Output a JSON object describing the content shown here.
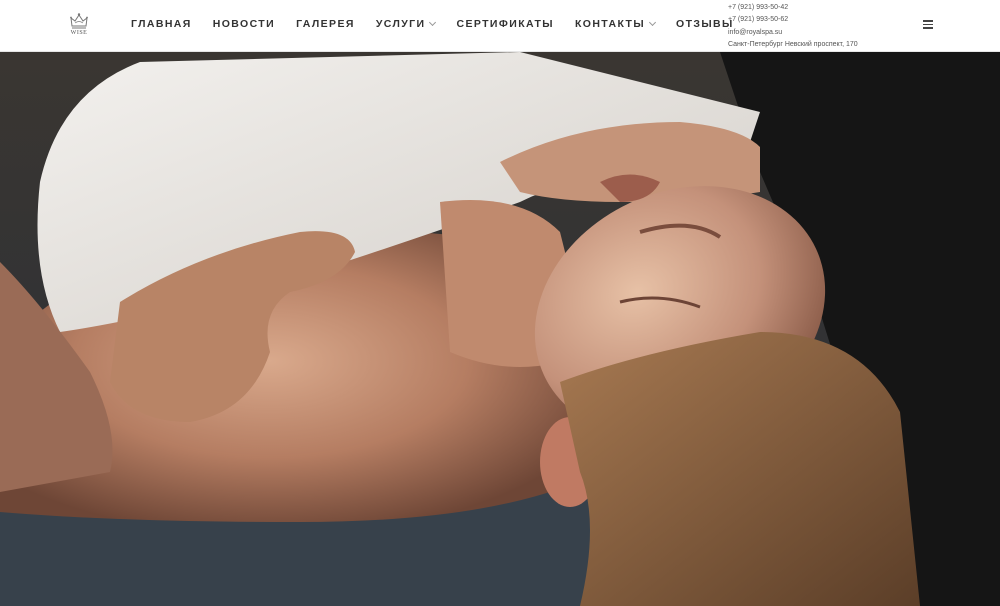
{
  "brand": {
    "logo_text": "WISE"
  },
  "nav": {
    "items": [
      {
        "label": "ГЛАВНАЯ",
        "dropdown": false
      },
      {
        "label": "НОВОСТИ",
        "dropdown": false
      },
      {
        "label": "ГАЛЕРЕЯ",
        "dropdown": false
      },
      {
        "label": "УСЛУГИ",
        "dropdown": true
      },
      {
        "label": "СЕРТИФИКАТЫ",
        "dropdown": false
      },
      {
        "label": "КОНТАКТЫ",
        "dropdown": true
      },
      {
        "label": "ОТЗЫВЫ",
        "dropdown": false
      }
    ]
  },
  "contacts": {
    "phone1": "+7 (921) 993-50-42",
    "phone2": "+7 (921) 993-50-62",
    "email": "info@royalspa.su",
    "address": "Санкт-Петербург Невский проспект, 170"
  },
  "icons": {
    "logo": "crown-emblem-icon",
    "menu": "hamburger-menu-icon",
    "dropdown": "chevron-down-icon"
  },
  "colors": {
    "header_bg": "#ffffff",
    "nav_text": "#333333",
    "contact_text": "#555555"
  }
}
